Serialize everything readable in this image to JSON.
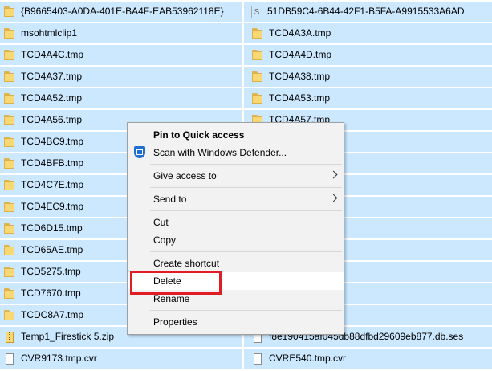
{
  "files": [
    {
      "name": "{B9665403-A0DA-401E-BA4F-EAB53962118E}",
      "icon": "folder-icon"
    },
    {
      "name": "51DB59C4-6B44-42F1-B5FA-A9915533A6AD",
      "icon": "document-icon"
    },
    {
      "name": "msohtmlclip1",
      "icon": "folder-icon"
    },
    {
      "name": "TCD4A3A.tmp",
      "icon": "folder-icon"
    },
    {
      "name": "TCD4A4C.tmp",
      "icon": "folder-icon"
    },
    {
      "name": "TCD4A4D.tmp",
      "icon": "folder-icon"
    },
    {
      "name": "TCD4A37.tmp",
      "icon": "folder-icon"
    },
    {
      "name": "TCD4A38.tmp",
      "icon": "folder-icon"
    },
    {
      "name": "TCD4A52.tmp",
      "icon": "folder-icon"
    },
    {
      "name": "TCD4A53.tmp",
      "icon": "folder-icon"
    },
    {
      "name": "TCD4A56.tmp",
      "icon": "folder-icon"
    },
    {
      "name": "TCD4A57.tmp",
      "icon": "folder-icon"
    },
    {
      "name": "TCD4BC9.tmp",
      "icon": "folder-icon"
    },
    {
      "name": "",
      "icon": "folder-icon"
    },
    {
      "name": "TCD4BFB.tmp",
      "icon": "folder-icon"
    },
    {
      "name": "",
      "icon": "folder-icon"
    },
    {
      "name": "TCD4C7E.tmp",
      "icon": "folder-icon"
    },
    {
      "name": "",
      "icon": "folder-icon"
    },
    {
      "name": "TCD4EC9.tmp",
      "icon": "folder-icon"
    },
    {
      "name": "",
      "icon": "folder-icon"
    },
    {
      "name": "TCD6D15.tmp",
      "icon": "folder-icon"
    },
    {
      "name": "",
      "icon": "folder-icon"
    },
    {
      "name": "TCD65AE.tmp",
      "icon": "folder-icon"
    },
    {
      "name": "",
      "icon": "folder-icon"
    },
    {
      "name": "TCD5275.tmp",
      "icon": "folder-icon"
    },
    {
      "name": "",
      "icon": "folder-icon"
    },
    {
      "name": "TCD7670.tmp",
      "icon": "folder-icon"
    },
    {
      "name": "",
      "icon": "folder-icon"
    },
    {
      "name": "TCDC8A7.tmp",
      "icon": "folder-icon"
    },
    {
      "name": "",
      "icon": "folder-icon"
    },
    {
      "name": "Temp1_Firestick 5.zip",
      "icon": "zip-icon"
    },
    {
      "name": "f8e190415af045db88dfbd29609eb877.db.ses",
      "icon": "file-icon"
    },
    {
      "name": "CVR9173.tmp.cvr",
      "icon": "file-icon"
    },
    {
      "name": "CVRE540.tmp.cvr",
      "icon": "file-icon"
    }
  ],
  "context_menu": {
    "pin": "Pin to Quick access",
    "scan": "Scan with Windows Defender...",
    "give_access": "Give access to",
    "send_to": "Send to",
    "cut": "Cut",
    "copy": "Copy",
    "create_shortcut": "Create shortcut",
    "delete": "Delete",
    "rename": "Rename",
    "properties": "Properties"
  },
  "colors": {
    "selection": "#cce8ff",
    "menu_bg": "#f2f2f2",
    "highlight_border": "#e01c24"
  }
}
